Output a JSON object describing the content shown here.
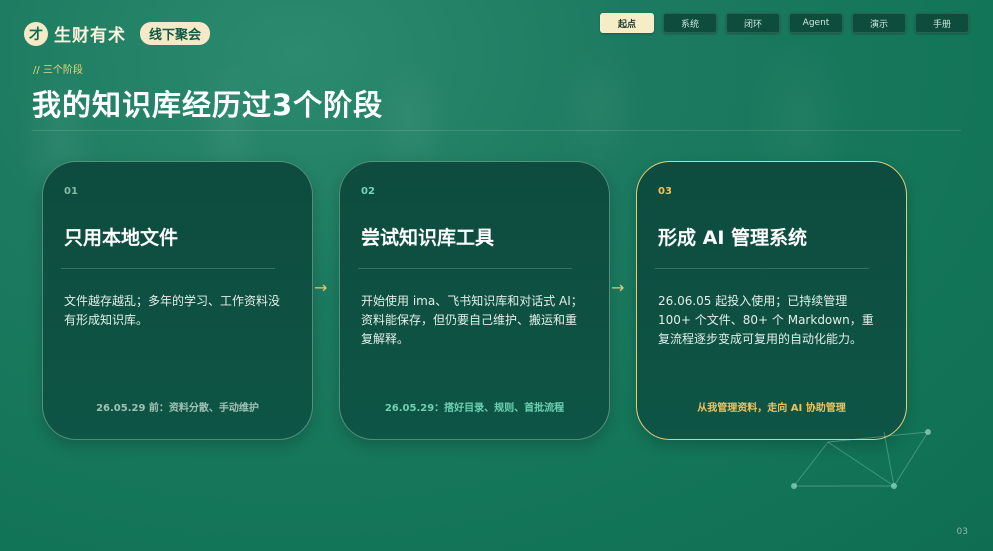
{
  "brand": {
    "mark": "才",
    "name": "生财有术",
    "badge": "线下聚会"
  },
  "nav": {
    "tabs": [
      {
        "label": "起点",
        "active": true
      },
      {
        "label": "系统",
        "active": false
      },
      {
        "label": "闭环",
        "active": false
      },
      {
        "label": "Agent",
        "active": false
      },
      {
        "label": "演示",
        "active": false
      },
      {
        "label": "手册",
        "active": false
      }
    ]
  },
  "header": {
    "kicker": "// 三个阶段",
    "title": "我的知识库经历过3个阶段"
  },
  "stages": [
    {
      "num": "01",
      "title": "只用本地文件",
      "body": "文件越存越乱；多年的学习、工作资料没有形成知识库。",
      "foot": "26.05.29 前：资料分散、手动维护"
    },
    {
      "num": "02",
      "title": "尝试知识库工具",
      "body": "开始使用 ima、飞书知识库和对话式 AI；资料能保存，但仍要自己维护、搬运和重复解释。",
      "foot": "26.05.29：搭好目录、规则、首批流程"
    },
    {
      "num": "03",
      "title": "形成 AI 管理系统",
      "body": "26.06.05 起投入使用；已持续管理 100+ 个文件、80+ 个 Markdown，重复流程逐步变成可复用的自动化能力。",
      "foot": "从我管理资料，走向 AI 协助管理"
    }
  ],
  "arrows": [
    "→",
    "→"
  ],
  "page_number": "03",
  "colors": {
    "accent": "#e6cf7a",
    "background": "#137558",
    "card": "#0d4c3e"
  }
}
